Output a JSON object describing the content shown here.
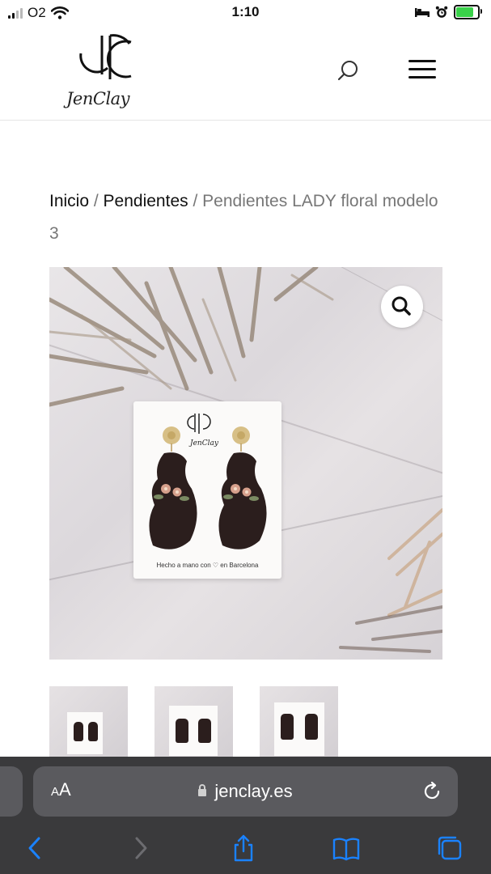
{
  "status_bar": {
    "carrier": "O2",
    "time": "1:10"
  },
  "header": {
    "logo_text": "JenClay"
  },
  "breadcrumb": {
    "home": "Inicio",
    "separator": " / ",
    "category": "Pendientes",
    "current": "Pendientes LADY floral modelo 3"
  },
  "product": {
    "card_caption": "Hecho a mano con ♡ en Barcelona",
    "card_logo_text": "JenClay",
    "thumbnail_count": 3
  },
  "browser": {
    "aa_label_small": "A",
    "aa_label_large": "A",
    "url": "jenclay.es"
  },
  "colors": {
    "accent_blue": "#1a82ff",
    "safari_bar": "#3a3a3c",
    "address_bar": "#5a5a5e",
    "earring_brown": "#2b1e1d"
  }
}
